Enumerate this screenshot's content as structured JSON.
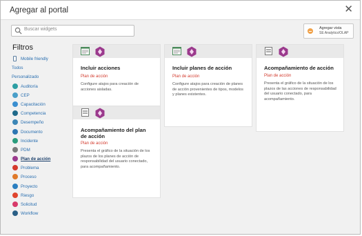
{
  "dialog": {
    "title": "Agregar al portal",
    "close_glyph": "✕"
  },
  "search": {
    "placeholder": "Buscar widgets"
  },
  "add_view": {
    "line1": "Agregar vista",
    "line2": "SE Analytics/OLAP"
  },
  "filters": {
    "title": "Filtros",
    "items": [
      {
        "label": "Mobile friendly",
        "icon": "phone-icon",
        "color": "#5b7d9f"
      },
      {
        "label": "Todos",
        "icon": "",
        "color": ""
      },
      {
        "label": "Personalizado",
        "icon": "",
        "color": ""
      },
      {
        "label": "Auditoría",
        "icon": "audit-icon",
        "color": "#2c9ea3"
      },
      {
        "label": "CEP",
        "icon": "cep-icon",
        "color": "#4a9fc9"
      },
      {
        "label": "Capacitación",
        "icon": "training-icon",
        "color": "#3a8fd0"
      },
      {
        "label": "Competencia",
        "icon": "competence-icon",
        "color": "#1f6a8a"
      },
      {
        "label": "Desempeño",
        "icon": "performance-icon",
        "color": "#3c86b6"
      },
      {
        "label": "Documento",
        "icon": "document-icon",
        "color": "#2e77b3"
      },
      {
        "label": "Incidente",
        "icon": "incident-icon",
        "color": "#2a9c7c"
      },
      {
        "label": "PDM",
        "icon": "pdm-icon",
        "color": "#7a7a7a"
      },
      {
        "label": "Plan de acción",
        "icon": "action-plan-icon",
        "color": "#9b3a8d",
        "active": true
      },
      {
        "label": "Problema",
        "icon": "problem-icon",
        "color": "#d5392c"
      },
      {
        "label": "Proceso",
        "icon": "process-icon",
        "color": "#e07a2a"
      },
      {
        "label": "Proyecto",
        "icon": "project-icon",
        "color": "#2b7fc0"
      },
      {
        "label": "Riesgo",
        "icon": "risk-icon",
        "color": "#e0442d"
      },
      {
        "label": "Solicitud",
        "icon": "request-icon",
        "color": "#d83a6a"
      },
      {
        "label": "Workflow",
        "icon": "workflow-icon",
        "color": "#2a5f86"
      }
    ]
  },
  "cards": [
    {
      "title": "Incluir acciones",
      "category": "Plan de acción",
      "description": "Configure atajos para creación de acciones aisladas.",
      "preview_icon": "form-icon"
    },
    {
      "title": "Incluir planes de acción",
      "category": "Plan de acción",
      "description": "Configure atajos para creación de planes de acción provenientes de tipos, modelos y planes existentes.",
      "preview_icon": "form-icon"
    },
    {
      "title": "Acompañamiento de acción",
      "category": "Plan de acción",
      "description": "Presenta el gráfico de la situación de los plazos de las acciones de responsabilidad del usuario conectado, para acompañamiento.",
      "preview_icon": "list-icon"
    },
    {
      "title": "Acompañamiento del plan de acción",
      "category": "Plan de acción",
      "description": "Presenta el gráfico de la situación de los plazos de los planes de acción de responsabilidad del usuario conectado, para acompañamiento.",
      "preview_icon": "list-icon"
    }
  ],
  "colors": {
    "accent_purple": "#9b3a8d",
    "category_red": "#d23a2d",
    "link_blue": "#2a6fb0"
  }
}
